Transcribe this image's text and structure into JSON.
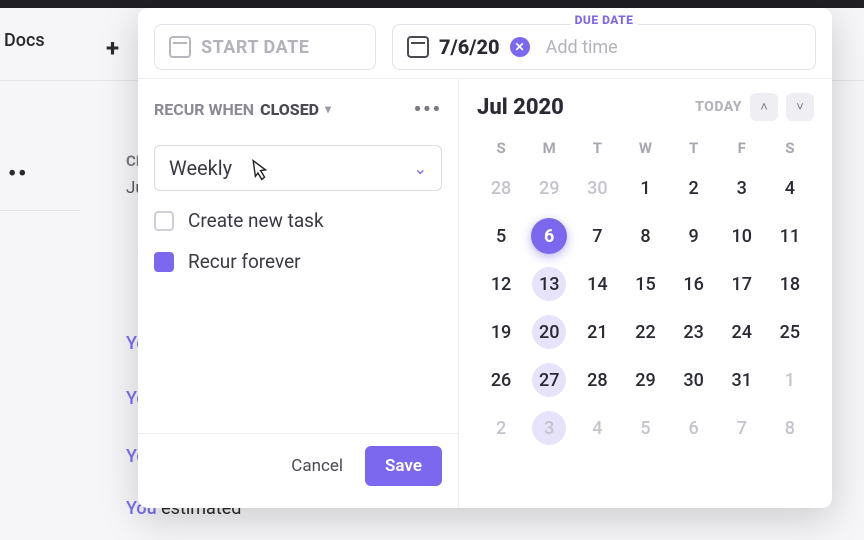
{
  "background": {
    "docs_label": "Docs",
    "plus": "+",
    "dots": "••",
    "truncated1": "CR",
    "truncated2": "Ju",
    "links": [
      "Yo",
      "Yo",
      "Yo",
      "You"
    ],
    "trail4": "estimated"
  },
  "date_inputs": {
    "start_placeholder": "START DATE",
    "due_label": "DUE DATE",
    "due_value": "7/6/20",
    "add_time": "Add time"
  },
  "recur": {
    "prefix": "RECUR WHEN",
    "status": "CLOSED",
    "frequency": "Weekly",
    "create_new_label": "Create new task",
    "create_new_checked": false,
    "recur_forever_label": "Recur forever",
    "recur_forever_checked": true,
    "more": "•••"
  },
  "footer": {
    "cancel": "Cancel",
    "save": "Save"
  },
  "calendar": {
    "month_label": "Jul 2020",
    "today_label": "TODAY",
    "dow": [
      "S",
      "M",
      "T",
      "W",
      "T",
      "F",
      "S"
    ],
    "weeks": [
      [
        {
          "n": 28,
          "muted": true
        },
        {
          "n": 29,
          "muted": true
        },
        {
          "n": 30,
          "muted": true
        },
        {
          "n": 1
        },
        {
          "n": 2
        },
        {
          "n": 3
        },
        {
          "n": 4
        }
      ],
      [
        {
          "n": 5
        },
        {
          "n": 6,
          "sel": true
        },
        {
          "n": 7
        },
        {
          "n": 8
        },
        {
          "n": 9
        },
        {
          "n": 10
        },
        {
          "n": 11
        }
      ],
      [
        {
          "n": 12
        },
        {
          "n": 13,
          "hl": true
        },
        {
          "n": 14
        },
        {
          "n": 15
        },
        {
          "n": 16
        },
        {
          "n": 17
        },
        {
          "n": 18
        }
      ],
      [
        {
          "n": 19
        },
        {
          "n": 20,
          "hl": true
        },
        {
          "n": 21
        },
        {
          "n": 22
        },
        {
          "n": 23
        },
        {
          "n": 24
        },
        {
          "n": 25
        }
      ],
      [
        {
          "n": 26
        },
        {
          "n": 27,
          "hl": true
        },
        {
          "n": 28
        },
        {
          "n": 29
        },
        {
          "n": 30
        },
        {
          "n": 31
        },
        {
          "n": 1,
          "muted": true
        }
      ],
      [
        {
          "n": 2,
          "muted": true
        },
        {
          "n": 3,
          "muted": true,
          "hl": true
        },
        {
          "n": 4,
          "muted": true
        },
        {
          "n": 5,
          "muted": true
        },
        {
          "n": 6,
          "muted": true
        },
        {
          "n": 7,
          "muted": true
        },
        {
          "n": 8,
          "muted": true
        }
      ]
    ]
  }
}
